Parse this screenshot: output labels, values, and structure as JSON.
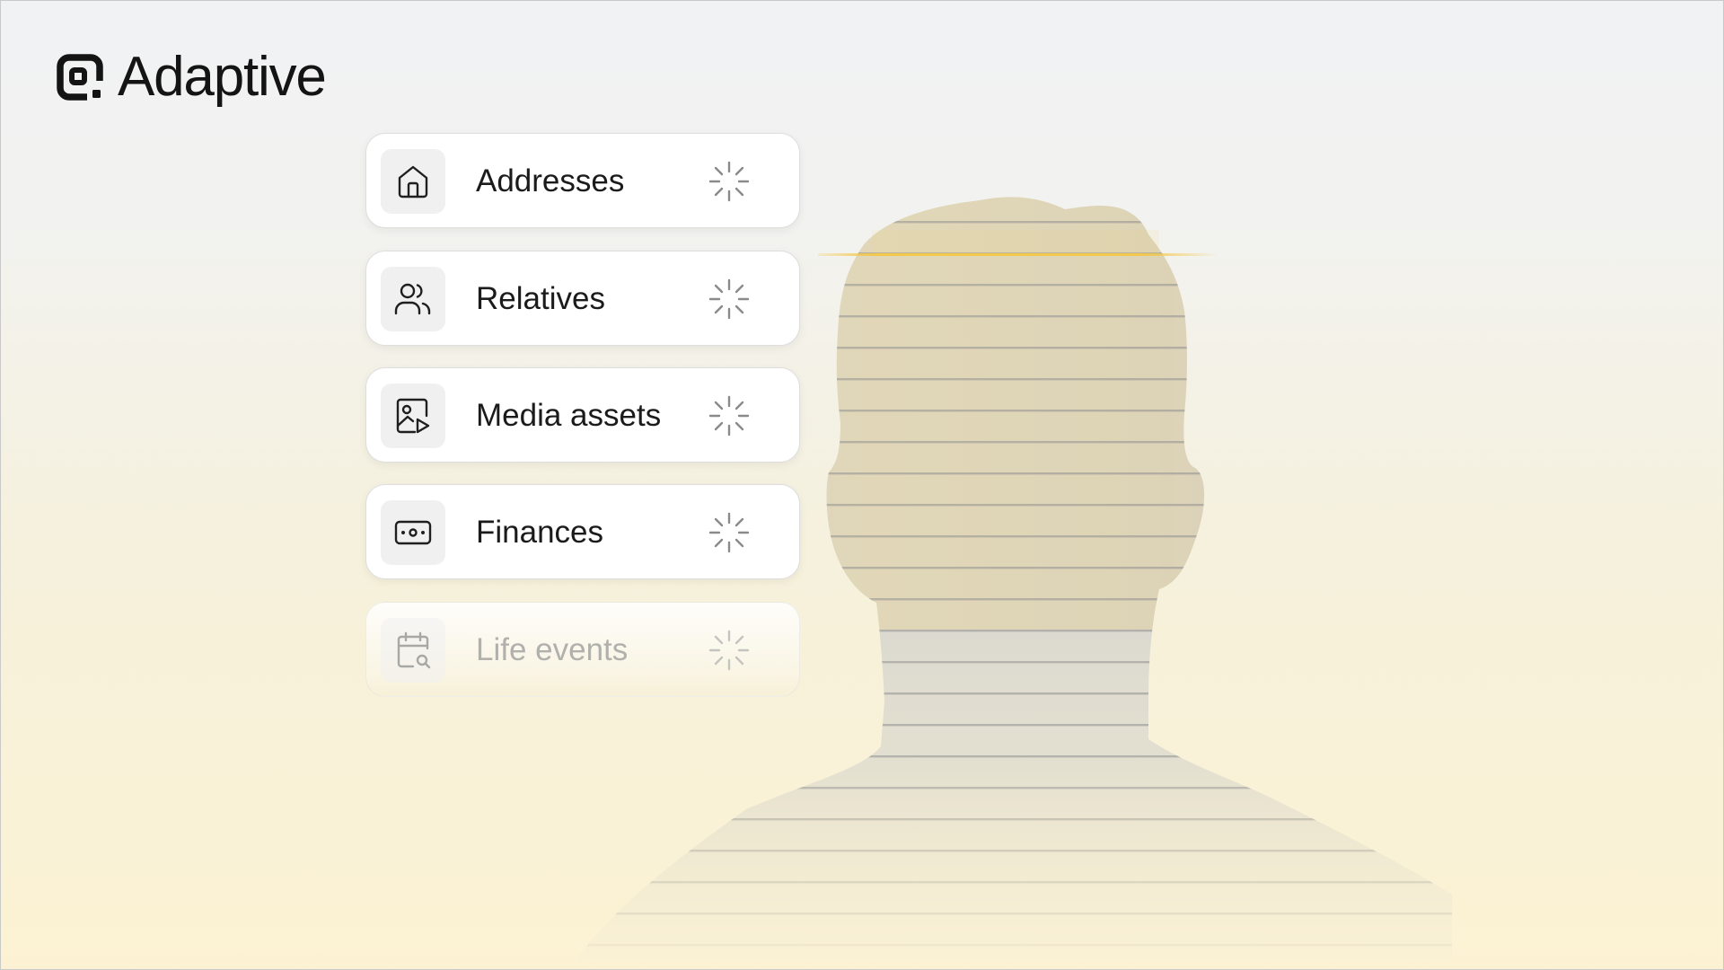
{
  "brand": {
    "name": "Adaptive",
    "logo_icon": "adaptive-logo-icon"
  },
  "cards": [
    {
      "label": "Addresses",
      "icon": "home-icon",
      "status": "loading"
    },
    {
      "label": "Relatives",
      "icon": "users-icon",
      "status": "loading"
    },
    {
      "label": "Media assets",
      "icon": "image-play-icon",
      "status": "loading"
    },
    {
      "label": "Finances",
      "icon": "banknote-icon",
      "status": "loading"
    },
    {
      "label": "Life events",
      "icon": "calendar-search-icon",
      "status": "loading"
    }
  ],
  "colors": {
    "scan_line": "#f2c94c",
    "text": "#1b1b1b",
    "faded_text": "#b0b0ac"
  }
}
